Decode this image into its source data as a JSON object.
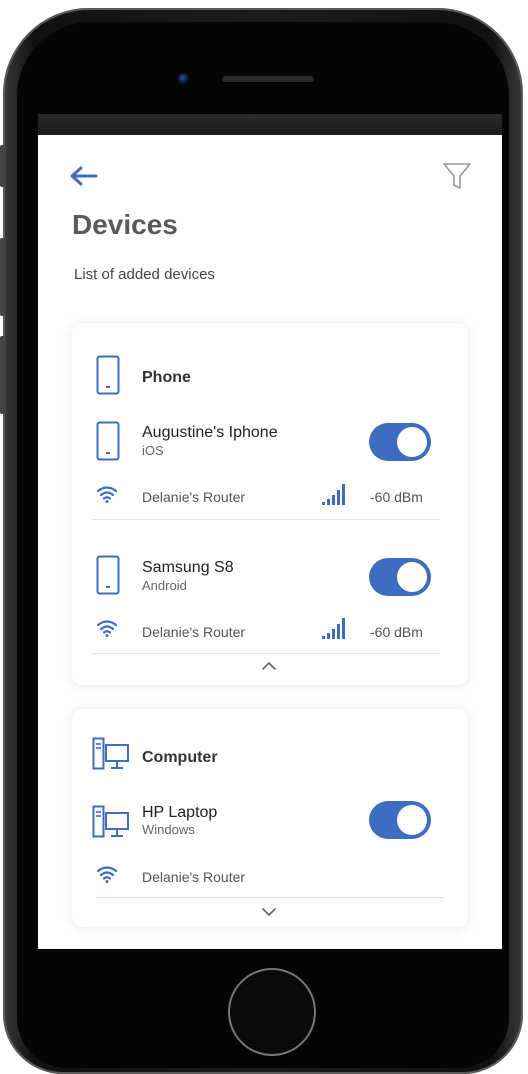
{
  "header": {
    "title": "Devices",
    "subtitle": "List of added devices"
  },
  "groups": [
    {
      "label": "Phone",
      "expanded": true,
      "devices": [
        {
          "name": "Augustine's Iphone",
          "os": "iOS",
          "router": "Delanie's Router",
          "signal": "-60 dBm",
          "enabled": true
        },
        {
          "name": "Samsung S8",
          "os": "Android",
          "router": "Delanie's Router",
          "signal": "-60 dBm",
          "enabled": true
        }
      ]
    },
    {
      "label": "Computer",
      "expanded": false,
      "devices": [
        {
          "name": "HP Laptop",
          "os": "Windows",
          "router": "Delanie's Router",
          "enabled": true
        }
      ]
    }
  ],
  "colors": {
    "accent": "#3d6cc0",
    "title": "#5a5a5a",
    "icon_gray": "#999999"
  },
  "icons": {
    "back": "arrow-left-icon",
    "filter": "funnel-icon",
    "phone": "smartphone-icon",
    "computer": "desktop-computer-icon",
    "wifi": "wifi-icon",
    "signal": "signal-bars-icon",
    "collapse": "chevron-up-icon",
    "expand": "chevron-down-icon"
  }
}
